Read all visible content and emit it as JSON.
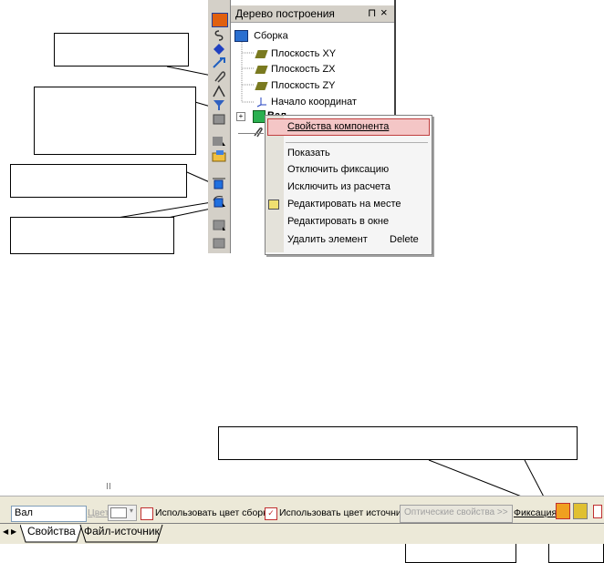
{
  "tree_panel": {
    "title": "Дерево построения",
    "pin_icon": "pin-icon",
    "close": "×",
    "root": "Сборка",
    "items": [
      "Плоскость XY",
      "Плоскость ZX",
      "Плоскость ZY",
      "Начало координат"
    ],
    "partial_item": "Вал"
  },
  "context_menu": {
    "items": [
      {
        "label": "Свойства компонента",
        "shortcut": ""
      },
      {
        "label": "Показать",
        "shortcut": ""
      },
      {
        "label": "Отключить фиксацию",
        "shortcut": ""
      },
      {
        "label": "Исключить из расчета",
        "shortcut": ""
      },
      {
        "label": "Редактировать на месте",
        "shortcut": ""
      },
      {
        "label": "Редактировать в окне",
        "shortcut": ""
      },
      {
        "label": "Удалить элемент",
        "shortcut": "Delete"
      }
    ]
  },
  "properties_bar": {
    "name_value": "Вал",
    "color_label": "Цвет",
    "use_assembly_color": "Использовать цвет сборки",
    "use_source_color": "Использовать цвет источника",
    "optical_button": "Оптические свойства  >>",
    "fixation_label": "Фиксация"
  },
  "tabs": {
    "properties": "Свойства",
    "source_file": "Файл-источник"
  },
  "colors": {
    "accent_red": "#c03030",
    "toolbar_bg": "#d4d0c8",
    "selection_bg": "#f4c6c6"
  }
}
